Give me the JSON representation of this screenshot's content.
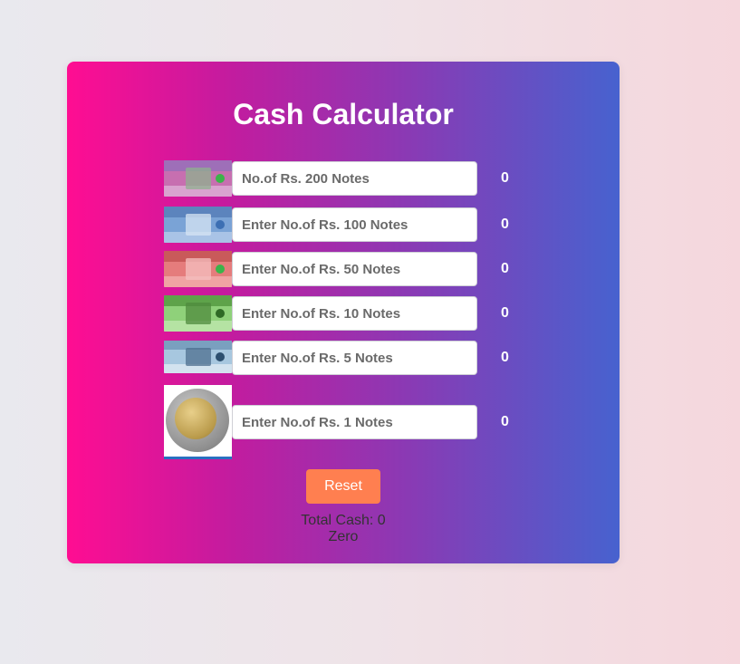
{
  "title": "Cash Calculator",
  "rows": [
    {
      "placeholder": "No.of Rs. 200 Notes",
      "amount": "0",
      "icon": "banknote-200-icon",
      "colors": [
        "#c76fb0",
        "#8fb08f",
        "#d9a3cf"
      ]
    },
    {
      "placeholder": "Enter No.of Rs. 100 Notes",
      "amount": "0",
      "icon": "banknote-100-icon",
      "colors": [
        "#7aa3d6",
        "#a9c3e6",
        "#5c84bd"
      ]
    },
    {
      "placeholder": "Enter No.of Rs. 50 Notes",
      "amount": "0",
      "icon": "banknote-50-icon",
      "colors": [
        "#e57c7c",
        "#f0a3a3",
        "#c95a5a"
      ]
    },
    {
      "placeholder": "Enter No.of Rs. 10 Notes",
      "amount": "0",
      "icon": "banknote-10-icon",
      "colors": [
        "#8fd17a",
        "#b5e3a3",
        "#5ea34a"
      ]
    },
    {
      "placeholder": "Enter No.of Rs. 5 Notes",
      "amount": "0",
      "icon": "banknote-5-icon",
      "colors": [
        "#a7c7df",
        "#d3e3ef",
        "#7aa0bf"
      ]
    },
    {
      "placeholder": "Enter No.of Rs. 1 Notes",
      "amount": "0",
      "icon": "coin-1-icon"
    }
  ],
  "reset_label": "Reset",
  "total_text": "Total Cash: 0",
  "total_words": "Zero"
}
